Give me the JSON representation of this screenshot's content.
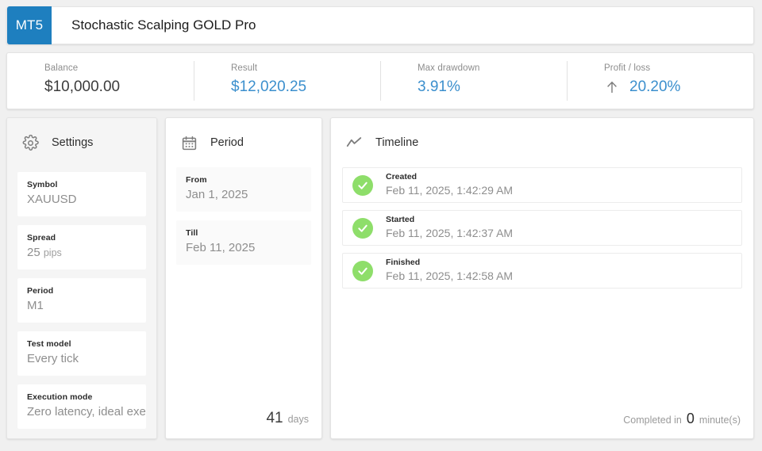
{
  "header": {
    "platform_badge": "MT5",
    "title": "Stochastic Scalping GOLD Pro",
    "badge_color": "#1e7fbf"
  },
  "stats": {
    "items": [
      {
        "label": "Balance",
        "value": "$10,000.00",
        "accent": false,
        "icon": ""
      },
      {
        "label": "Result",
        "value": "$12,020.25",
        "accent": true,
        "icon": ""
      },
      {
        "label": "Max drawdown",
        "value": "3.91%",
        "accent": true,
        "icon": ""
      },
      {
        "label": "Profit / loss",
        "value": "20.20%",
        "accent": true,
        "icon": "arrow-up-icon"
      }
    ],
    "accent_color": "#3b8fcd"
  },
  "settings": {
    "icon": "gear-icon",
    "title": "Settings",
    "rows": [
      {
        "label": "Symbol",
        "value": "XAUUSD",
        "unit": ""
      },
      {
        "label": "Spread",
        "value": "25",
        "unit": "pips"
      },
      {
        "label": "Period",
        "value": "M1",
        "unit": ""
      },
      {
        "label": "Test model",
        "value": "Every tick",
        "unit": ""
      },
      {
        "label": "Execution mode",
        "value": "Zero latency, ideal execution",
        "unit": ""
      }
    ]
  },
  "period": {
    "icon": "calendar-icon",
    "title": "Period",
    "rows": [
      {
        "label": "From",
        "value": "Jan 1, 2025"
      },
      {
        "label": "Till",
        "value": "Feb 11, 2025"
      }
    ],
    "footer": {
      "count": "41",
      "unit": "days"
    }
  },
  "timeline": {
    "icon": "trending-line-icon",
    "title": "Timeline",
    "status_color": "#8ede6a",
    "items": [
      {
        "label": "Created",
        "time": "Feb 11, 2025, 1:42:29 AM",
        "status": "check-icon"
      },
      {
        "label": "Started",
        "time": "Feb 11, 2025, 1:42:37 AM",
        "status": "check-icon"
      },
      {
        "label": "Finished",
        "time": "Feb 11, 2025, 1:42:58 AM",
        "status": "check-icon"
      }
    ],
    "footer": {
      "prefix": "Completed in",
      "count": "0",
      "suffix": "minute(s)"
    }
  }
}
